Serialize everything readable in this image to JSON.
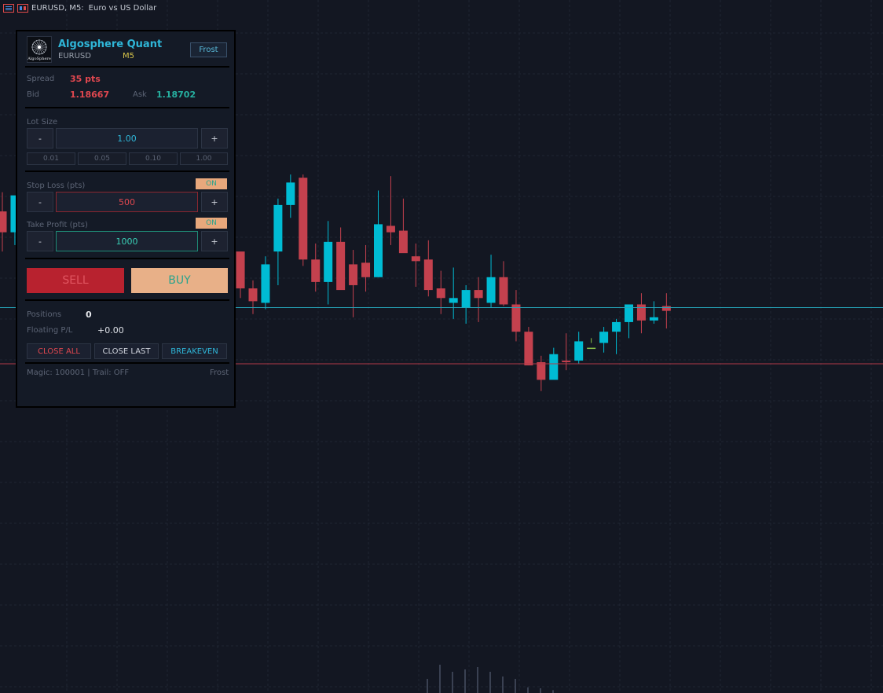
{
  "title_bar": {
    "symbol_info": "EURUSD, M5:",
    "description": "Euro vs US Dollar"
  },
  "panel": {
    "app_name": "Algosphere Quant",
    "logo_text": "AlgoSphere",
    "symbol": "EURUSD",
    "timeframe": "M5",
    "theme_button": "Frost",
    "spread_label": "Spread",
    "spread_value": "35 pts",
    "bid_label": "Bid",
    "bid_value": "1.18667",
    "ask_label": "Ask",
    "ask_value": "1.18702",
    "lot_label": "Lot Size",
    "lot_value": "1.00",
    "minus": "-",
    "plus": "+",
    "lot_quick": [
      "0.01",
      "0.05",
      "0.10",
      "1.00"
    ],
    "sl_label": "Stop Loss (pts)",
    "sl_toggle": "ON",
    "sl_value": "500",
    "tp_label": "Take Profit (pts)",
    "tp_toggle": "ON",
    "tp_value": "1000",
    "sell_label": "SELL",
    "buy_label": "BUY",
    "positions_label": "Positions",
    "positions_value": "0",
    "pl_label": "Floating P/L",
    "pl_value": "+0.00",
    "close_all": "CLOSE ALL",
    "close_last": "CLOSE LAST",
    "breakeven": "BREAKEVEN",
    "footer_left": "Magic: 100001  |  Trail: OFF",
    "footer_right": "Frost"
  },
  "colors": {
    "bull": "#00bcd4",
    "bear": "#c4414e",
    "doji": "#8bc34a",
    "bg": "#131722",
    "ask_line": "#26a4b8",
    "bid_line": "#b23a48"
  },
  "chart_data": {
    "type": "candlestick",
    "symbol": "EURUSD",
    "timeframe": "M5",
    "bid": 1.18667,
    "ask": 1.18702,
    "candles": [
      {
        "o": 1.18762,
        "h": 1.18774,
        "l": 1.18737,
        "c": 1.18749
      },
      {
        "o": 1.18749,
        "h": 1.1877,
        "l": 1.18741,
        "c": 1.18772
      },
      {
        "o": 1.18798,
        "h": 1.1882,
        "l": 1.18778,
        "c": 1.18787
      },
      {
        "o": 1.18787,
        "h": 1.1882,
        "l": 1.1878,
        "c": 1.18797
      },
      {
        "o": 1.18783,
        "h": 1.18829,
        "l": 1.18783,
        "c": 1.18821
      },
      {
        "o": 1.18821,
        "h": 1.18842,
        "l": 1.1881,
        "c": 1.18839
      },
      {
        "o": 1.18839,
        "h": 1.18845,
        "l": 1.18828,
        "c": 1.18832
      },
      {
        "o": 1.18832,
        "h": 1.18853,
        "l": 1.18828,
        "c": 1.18852
      },
      {
        "o": 1.18853,
        "h": 1.18855,
        "l": 1.18833,
        "c": 1.18841
      },
      {
        "o": 1.18834,
        "h": 1.18834,
        "l": 1.18795,
        "c": 1.18799
      },
      {
        "o": 1.18801,
        "h": 1.18833,
        "l": 1.18801,
        "c": 1.18825
      },
      {
        "o": 1.18827,
        "h": 1.1885,
        "l": 1.1882,
        "c": 1.18823
      },
      {
        "o": 1.18823,
        "h": 1.18855,
        "l": 1.18818,
        "c": 1.18859
      },
      {
        "o": 1.18859,
        "h": 1.1886,
        "l": 1.18844,
        "c": 1.18853
      },
      {
        "o": 1.18853,
        "h": 1.18854,
        "l": 1.18838,
        "c": 1.18849
      },
      {
        "o": 1.18849,
        "h": 1.1887,
        "l": 1.18838,
        "c": 1.18858
      },
      {
        "o": 1.18861,
        "h": 1.18871,
        "l": 1.1886,
        "c": 1.1886
      },
      {
        "o": 1.18859,
        "h": 1.18859,
        "l": 1.18722,
        "c": 1.18737
      },
      {
        "o": 1.18737,
        "h": 1.18745,
        "l": 1.18716,
        "c": 1.18737
      },
      {
        "o": 1.18737,
        "h": 1.18736,
        "l": 1.18708,
        "c": 1.18714
      },
      {
        "o": 1.18714,
        "h": 1.18719,
        "l": 1.18698,
        "c": 1.18706
      },
      {
        "o": 1.18705,
        "h": 1.18734,
        "l": 1.18701,
        "c": 1.18729
      },
      {
        "o": 1.18737,
        "h": 1.1877,
        "l": 1.18716,
        "c": 1.18766
      },
      {
        "o": 1.18766,
        "h": 1.18785,
        "l": 1.18758,
        "c": 1.1878
      },
      {
        "o": 1.18783,
        "h": 1.18785,
        "l": 1.18728,
        "c": 1.18732
      },
      {
        "o": 1.18732,
        "h": 1.18742,
        "l": 1.18712,
        "c": 1.18718
      },
      {
        "o": 1.18718,
        "h": 1.18756,
        "l": 1.18704,
        "c": 1.18743
      },
      {
        "o": 1.18743,
        "h": 1.18752,
        "l": 1.18716,
        "c": 1.18713
      },
      {
        "o": 1.18729,
        "h": 1.18738,
        "l": 1.18696,
        "c": 1.18716
      },
      {
        "o": 1.1873,
        "h": 1.18741,
        "l": 1.18712,
        "c": 1.18721
      },
      {
        "o": 1.18721,
        "h": 1.18775,
        "l": 1.18721,
        "c": 1.18754
      },
      {
        "o": 1.18753,
        "h": 1.18784,
        "l": 1.18741,
        "c": 1.18749
      },
      {
        "o": 1.1875,
        "h": 1.1877,
        "l": 1.18738,
        "c": 1.18736
      },
      {
        "o": 1.18734,
        "h": 1.18742,
        "l": 1.18715,
        "c": 1.18731
      },
      {
        "o": 1.18732,
        "h": 1.18744,
        "l": 1.18709,
        "c": 1.18713
      },
      {
        "o": 1.18714,
        "h": 1.18725,
        "l": 1.18698,
        "c": 1.18708
      },
      {
        "o": 1.18705,
        "h": 1.18727,
        "l": 1.18695,
        "c": 1.18708
      },
      {
        "o": 1.18702,
        "h": 1.18716,
        "l": 1.18692,
        "c": 1.18713
      },
      {
        "o": 1.18713,
        "h": 1.18721,
        "l": 1.18693,
        "c": 1.18708
      },
      {
        "o": 1.18705,
        "h": 1.18735,
        "l": 1.18702,
        "c": 1.18721
      },
      {
        "o": 1.18721,
        "h": 1.18731,
        "l": 1.18703,
        "c": 1.18704
      },
      {
        "o": 1.18704,
        "h": 1.18713,
        "l": 1.18681,
        "c": 1.18687
      },
      {
        "o": 1.18687,
        "h": 1.1869,
        "l": 1.18666,
        "c": 1.18666
      },
      {
        "o": 1.18668,
        "h": 1.18672,
        "l": 1.1865,
        "c": 1.18657
      },
      {
        "o": 1.18657,
        "h": 1.18677,
        "l": 1.18659,
        "c": 1.18673
      },
      {
        "o": 1.18669,
        "h": 1.18686,
        "l": 1.18663,
        "c": 1.18668
      },
      {
        "o": 1.18669,
        "h": 1.18687,
        "l": 1.18667,
        "c": 1.18681
      },
      {
        "o": 1.18677,
        "h": 1.18683,
        "l": 1.1868,
        "c": 1.18677
      },
      {
        "o": 1.1868,
        "h": 1.1869,
        "l": 1.18674,
        "c": 1.18687
      },
      {
        "o": 1.18687,
        "h": 1.18695,
        "l": 1.18673,
        "c": 1.18693
      },
      {
        "o": 1.18693,
        "h": 1.18702,
        "l": 1.18683,
        "c": 1.18704
      },
      {
        "o": 1.18704,
        "h": 1.18711,
        "l": 1.18686,
        "c": 1.18694
      },
      {
        "o": 1.18694,
        "h": 1.18706,
        "l": 1.18692,
        "c": 1.18696
      },
      {
        "o": 1.18703,
        "h": 1.18711,
        "l": 1.18689,
        "c": 1.187
      }
    ],
    "volume": [
      0.3,
      0.6,
      0.45,
      0.5,
      0.55,
      0.45,
      0.35,
      0.3,
      0.12,
      0.1,
      0.06
    ]
  }
}
